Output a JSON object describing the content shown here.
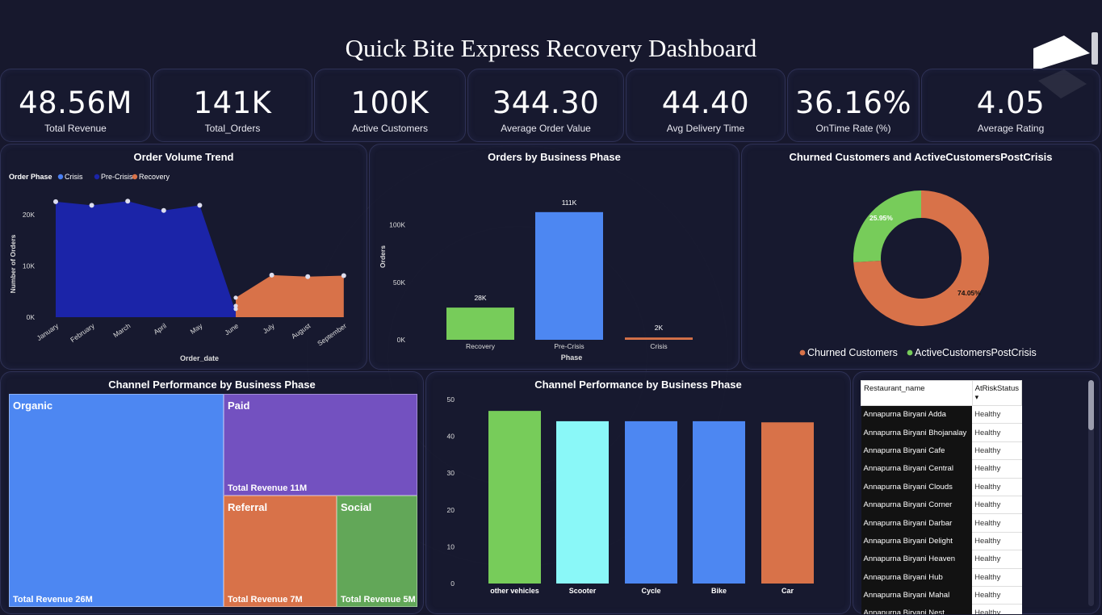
{
  "header": {
    "title": "Quick Bite Express Recovery Dashboard"
  },
  "kpis": [
    {
      "value": "48.56M",
      "label": "Total Revenue"
    },
    {
      "value": "141K",
      "label": "Total_Orders"
    },
    {
      "value": "100K",
      "label": "Active Customers"
    },
    {
      "value": "344.30",
      "label": "Average Order Value"
    },
    {
      "value": "44.40",
      "label": "Avg Delivery Time"
    },
    {
      "value": "36.16%",
      "label": "OnTime Rate (%)"
    },
    {
      "value": "4.05",
      "label": "Average Rating"
    }
  ],
  "colors": {
    "crisis": "#4a7ff2",
    "pre_crisis": "#1b24a8",
    "recovery": "#d87249",
    "green": "#77cc5a",
    "blue": "#4d87f2",
    "cyan": "#8af8f8",
    "purple": "#7351c0",
    "social": "#62a758",
    "bg": "#17182d"
  },
  "order_volume": {
    "title": "Order Volume Trend",
    "legend_title": "Order Phase",
    "legend": [
      "Crisis",
      "Pre-Crisis",
      "Recovery"
    ],
    "xlabel": "Order_date",
    "ylabel": "Number of Orders",
    "ytick_labels": [
      "0K",
      "10K",
      "20K"
    ]
  },
  "orders_by_phase": {
    "title": "Orders by Business Phase",
    "xlabel": "Phase",
    "ylabel": "Orders",
    "ytick_labels": [
      "0K",
      "50K",
      "100K"
    ]
  },
  "churn": {
    "title": "Churned Customers and ActiveCustomersPostCrisis",
    "legend": [
      "Churned Customers",
      "ActiveCustomersPostCrisis"
    ],
    "labels": [
      "74.05%",
      "25.95%"
    ]
  },
  "treemap": {
    "title": "Channel Performance by Business Phase",
    "cells": [
      {
        "name": "Organic",
        "value_label": "Total Revenue 26M"
      },
      {
        "name": "Paid",
        "value_label": "Total Revenue 11M"
      },
      {
        "name": "Referral",
        "value_label": "Total Revenue 7M"
      },
      {
        "name": "Social",
        "value_label": "Total Revenue 5M"
      }
    ]
  },
  "vehicle_chart": {
    "title": "Channel Performance by Business Phase",
    "ytick_labels": [
      "0",
      "10",
      "20",
      "30",
      "40",
      "50"
    ]
  },
  "restaurant_table": {
    "headers": [
      "Restaurant_name",
      "AtRiskStatus"
    ],
    "sort_indicator": "▾",
    "rows": [
      [
        "Annapurna Biryani Adda",
        "Healthy"
      ],
      [
        "Annapurna Biryani Bhojanalay",
        "Healthy"
      ],
      [
        "Annapurna Biryani Cafe",
        "Healthy"
      ],
      [
        "Annapurna Biryani Central",
        "Healthy"
      ],
      [
        "Annapurna Biryani Clouds",
        "Healthy"
      ],
      [
        "Annapurna Biryani Corner",
        "Healthy"
      ],
      [
        "Annapurna Biryani Darbar",
        "Healthy"
      ],
      [
        "Annapurna Biryani Delight",
        "Healthy"
      ],
      [
        "Annapurna Biryani Heaven",
        "Healthy"
      ],
      [
        "Annapurna Biryani Hub",
        "Healthy"
      ],
      [
        "Annapurna Biryani Mahal",
        "Healthy"
      ],
      [
        "Annapurna Biryani Nest",
        "Healthy"
      ]
    ]
  },
  "chart_data": [
    {
      "type": "area",
      "title": "Order Volume Trend",
      "xlabel": "Order_date",
      "ylabel": "Number of Orders",
      "categories": [
        "January",
        "February",
        "March",
        "April",
        "May",
        "June",
        "July",
        "August",
        "September"
      ],
      "ylim": [
        0,
        25000
      ],
      "series": [
        {
          "name": "Pre-Crisis",
          "values": [
            22500,
            21800,
            22600,
            20800,
            21800,
            null,
            null,
            null,
            null
          ]
        },
        {
          "name": "Crisis",
          "values": [
            null,
            null,
            null,
            null,
            null,
            1000,
            null,
            null,
            null
          ]
        },
        {
          "name": "Recovery",
          "values": [
            null,
            null,
            null,
            null,
            null,
            null,
            8200,
            7900,
            8100
          ]
        }
      ],
      "crisis_points": [
        1600,
        2200,
        3800
      ]
    },
    {
      "type": "bar",
      "title": "Orders by Business Phase",
      "xlabel": "Phase",
      "ylabel": "Orders",
      "categories": [
        "Recovery",
        "Pre-Crisis",
        "Crisis"
      ],
      "values": [
        28000,
        111000,
        2000
      ],
      "data_labels": [
        "28K",
        "111K",
        "2K"
      ],
      "ylim": [
        0,
        120000
      ]
    },
    {
      "type": "pie",
      "title": "Churned Customers and ActiveCustomersPostCrisis",
      "categories": [
        "Churned Customers",
        "ActiveCustomersPostCrisis"
      ],
      "values": [
        74.05,
        25.95
      ],
      "legend": "bottom"
    },
    {
      "type": "bar",
      "title": "Channel Performance by Business Phase",
      "categories": [
        "other vehicles",
        "Scooter",
        "Cycle",
        "Bike",
        "Car"
      ],
      "values": [
        46.9,
        44.1,
        44.1,
        44.1,
        43.8
      ],
      "ylim": [
        0,
        50
      ]
    }
  ]
}
